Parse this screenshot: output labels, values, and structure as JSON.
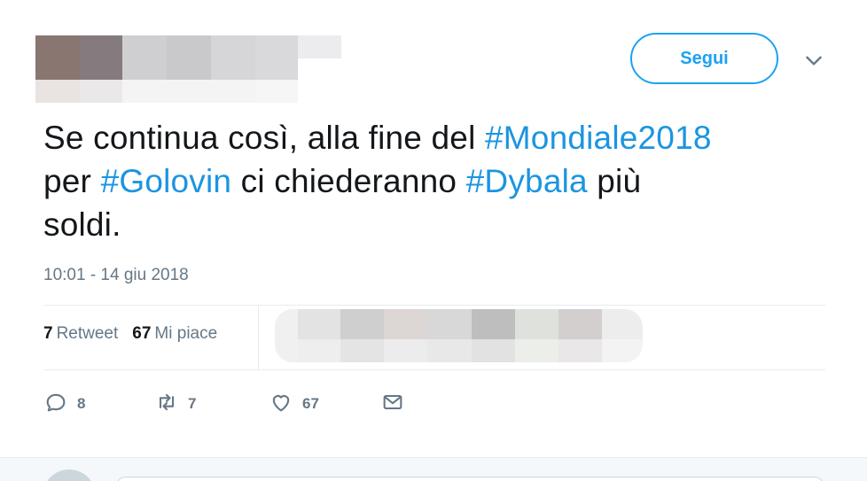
{
  "header": {
    "follow_label": "Segui",
    "caret_icon": "chevron-down-icon"
  },
  "tweet": {
    "text_1": "Se continua così, alla fine del ",
    "hashtag_1": "#Mondiale2018",
    "text_2": "per ",
    "hashtag_2": "#Golovin",
    "text_3": " ci chiederanno ",
    "hashtag_3": "#Dybala",
    "text_4": " più",
    "text_5": "soldi.",
    "timestamp": "10:01 - 14 giu 2018"
  },
  "stats": {
    "retweets_count": "7",
    "retweets_label": "Retweet",
    "likes_count": "67",
    "likes_label": "Mi piace"
  },
  "actions": {
    "reply_count": "8",
    "retweet_count": "7",
    "like_count": "67"
  },
  "colors": {
    "accent": "#1da1f2",
    "hashtag": "#1b95e0",
    "muted": "#657786"
  }
}
